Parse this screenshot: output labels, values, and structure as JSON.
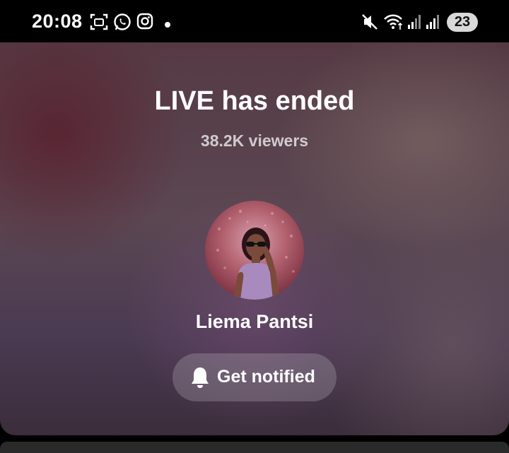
{
  "status_bar": {
    "time": "20:08",
    "left_icons": [
      "screenshot-icon",
      "whatsapp-icon",
      "instagram-icon",
      "notification-dot-icon"
    ],
    "right_icons": [
      "mute-icon",
      "wifi-icon",
      "signal-icon",
      "signal-icon"
    ],
    "battery": "23"
  },
  "live": {
    "title": "LIVE has ended",
    "viewers": "38.2K viewers",
    "host_name": "Liema Pantsi",
    "notify_label": "Get notified",
    "notify_icon": "bell-icon"
  },
  "colors": {
    "background": "#000000",
    "text": "#ffffff",
    "button_bg": "rgba(255,255,255,0.18)"
  }
}
